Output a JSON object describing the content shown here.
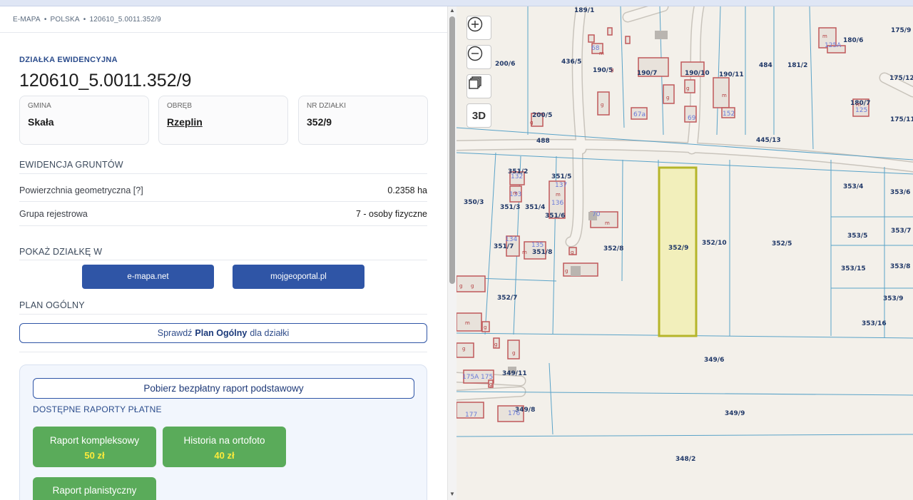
{
  "breadcrumb": [
    "E-MAPA",
    "POLSKA",
    "120610_5.0011.352/9"
  ],
  "parcel": {
    "section_label": "DZIAŁKA EWIDENCYJNA",
    "id": "120610_5.0011.352/9",
    "cards": [
      {
        "label": "GMINA",
        "value": "Skała"
      },
      {
        "label": "OBRĘB",
        "value": "Rzeplin"
      },
      {
        "label": "NR DZIAŁKI",
        "value": "352/9"
      }
    ]
  },
  "land_registry": {
    "title": "EWIDENCJA GRUNTÓW",
    "rows": [
      {
        "label": "Powierzchnia geometryczna [?]",
        "value": "0.2358 ha"
      },
      {
        "label": "Grupa rejestrowa",
        "value": "7 - osoby fizyczne"
      }
    ]
  },
  "show_in": {
    "title": "POKAŻ DZIAŁKĘ W",
    "buttons": [
      "e-mapa.net",
      "mojgeoportal.pl"
    ]
  },
  "plan": {
    "title": "PLAN OGÓLNY",
    "button_pre": "Sprawdź",
    "button_bold": "Plan Ogólny",
    "button_post": "dla działki"
  },
  "reports": {
    "free_button": "Pobierz bezpłatny raport podstawowy",
    "paid_title": "DOSTĘPNE RAPORTY PŁATNE",
    "items": [
      {
        "name": "Raport kompleksowy",
        "price": "50 zł"
      },
      {
        "name": "Historia na ortofoto",
        "price": "40 zł"
      },
      {
        "name": "Raport planistyczny",
        "price": ""
      }
    ]
  },
  "map": {
    "controls": {
      "zoom_in": "+",
      "zoom_out": "−",
      "view3d": "3D"
    },
    "selected_parcel": "352/9",
    "selected_color": "#b5b52a",
    "parcel_labels": [
      "189/1",
      "200/6",
      "436/5",
      "190/5",
      "190/7",
      "190/10",
      "190/11",
      "484",
      "181/2",
      "180/6",
      "175/9",
      "175/12",
      "180/7",
      "175/11",
      "200/5",
      "488",
      "445/13",
      "351/2",
      "351/5",
      "350/3",
      "351/3",
      "351/4",
      "351/6",
      "352/8",
      "352/9",
      "352/10",
      "352/5",
      "353/4",
      "353/6",
      "353/5",
      "353/7",
      "351/7",
      "351/8",
      "353/15",
      "353/8",
      "352/7",
      "353/9",
      "353/16",
      "349/6",
      "349/11",
      "349/8",
      "349/9",
      "348/2"
    ],
    "building_labels": [
      "68",
      "67a",
      "69",
      "152",
      "125A",
      "125",
      "132",
      "133",
      "137",
      "136",
      "134",
      "135",
      "70",
      "175A",
      "175",
      "177",
      "176"
    ]
  }
}
